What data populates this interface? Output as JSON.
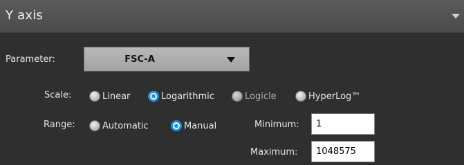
{
  "header": {
    "title": "Y axis"
  },
  "parameter": {
    "label": "Parameter:",
    "selected": "FSC-A"
  },
  "scale": {
    "label": "Scale:",
    "options": [
      {
        "label": "Linear",
        "selected": false,
        "enabled": true
      },
      {
        "label": "Logarithmic",
        "selected": true,
        "enabled": true
      },
      {
        "label": "Logicle",
        "selected": false,
        "enabled": false
      },
      {
        "label": "HyperLog™",
        "selected": false,
        "enabled": true
      }
    ]
  },
  "range": {
    "label": "Range:",
    "options": [
      {
        "label": "Automatic",
        "selected": false,
        "enabled": true
      },
      {
        "label": "Manual",
        "selected": true,
        "enabled": true
      }
    ],
    "minimum": {
      "label": "Minimum:",
      "value": "1"
    },
    "maximum": {
      "label": "Maximum:",
      "value": "1048575"
    }
  },
  "colors": {
    "accent": "#1f8fe0",
    "header": "#555555",
    "background": "#2f2f2f"
  }
}
